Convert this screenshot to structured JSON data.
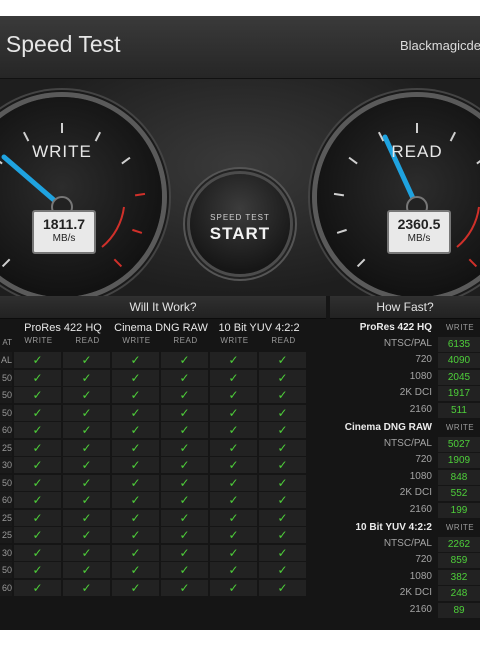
{
  "window": {
    "title": "k Speed Test",
    "brand": "Blackmagicdes"
  },
  "gauges": {
    "write": {
      "label": "WRITE",
      "value": "1811.7",
      "unit": "MB/s"
    },
    "read": {
      "label": "READ",
      "value": "2360.5",
      "unit": "MB/s"
    }
  },
  "start_button": {
    "small": "SPEED TEST",
    "big": "START"
  },
  "icons": {
    "settings": "gear-icon",
    "check": "checkmark-icon"
  },
  "colors": {
    "check": "#4ecf3a",
    "needle": "#1fa3e0",
    "redline": "#d0302a"
  },
  "will_it_work": {
    "title": "Will It Work?",
    "formats": [
      "ProRes 422 HQ",
      "Cinema DNG RAW",
      "10 Bit YUV 4:2:2"
    ],
    "sub_labels": [
      "WRITE",
      "READ"
    ],
    "corner_label": "AT",
    "row_labels": [
      "AL",
      "50",
      "50",
      "50",
      "60",
      "25",
      "30",
      "50",
      "60",
      "25",
      "25",
      "30",
      "50",
      "60"
    ],
    "check": "✓"
  },
  "how_fast": {
    "title": "How Fast?",
    "groups": [
      {
        "name": "ProRes 422 HQ",
        "sub": "WRITE",
        "rows": [
          {
            "label": "NTSC/PAL",
            "value": "6135"
          },
          {
            "label": "720",
            "value": "4090"
          },
          {
            "label": "1080",
            "value": "2045"
          },
          {
            "label": "2K DCI",
            "value": "1917"
          },
          {
            "label": "2160",
            "value": "511"
          }
        ]
      },
      {
        "name": "Cinema DNG RAW",
        "sub": "WRITE",
        "rows": [
          {
            "label": "NTSC/PAL",
            "value": "5027"
          },
          {
            "label": "720",
            "value": "1909"
          },
          {
            "label": "1080",
            "value": "848"
          },
          {
            "label": "2K DCI",
            "value": "552"
          },
          {
            "label": "2160",
            "value": "199"
          }
        ]
      },
      {
        "name": "10 Bit YUV 4:2:2",
        "sub": "WRITE",
        "rows": [
          {
            "label": "NTSC/PAL",
            "value": "2262"
          },
          {
            "label": "720",
            "value": "859"
          },
          {
            "label": "1080",
            "value": "382"
          },
          {
            "label": "2K DCI",
            "value": "248"
          },
          {
            "label": "2160",
            "value": "89"
          }
        ]
      }
    ]
  }
}
